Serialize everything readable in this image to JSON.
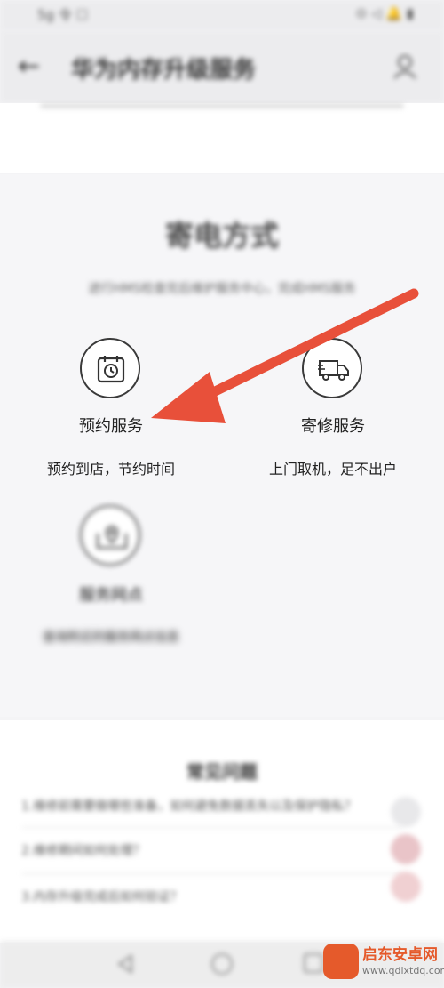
{
  "status_bar": {
    "left": "5g 令 ☐",
    "right": "⊙ ◁ 🔔 ▮"
  },
  "header": {
    "title": "华为内存升级服务"
  },
  "section": {
    "title": "寄电方式",
    "subtitle": "进行HMS检查完后维护服务中心，完成HMS服务"
  },
  "services": [
    {
      "label": "预约服务",
      "desc": "预约到店，节约时间",
      "icon": "calendar-clock-icon"
    },
    {
      "label": "寄修服务",
      "desc": "上门取机，足不出户",
      "icon": "delivery-truck-icon"
    },
    {
      "label": "服务网点",
      "desc": "查询附近的服务网点信息",
      "icon": "location-pin-icon"
    }
  ],
  "faq": {
    "title": "常见问题",
    "items": [
      "1.维修前需要做哪些准备，如何避免数据丢失以及保护隐私？",
      "2.维修期间如何处理？",
      "3.内存升级完成后如何验证？"
    ]
  },
  "watermark": {
    "name": "启东安卓网",
    "url": "www.qdlxtdq.com"
  },
  "colors": {
    "arrow": "#e8503a",
    "icon_stroke": "#333333"
  }
}
